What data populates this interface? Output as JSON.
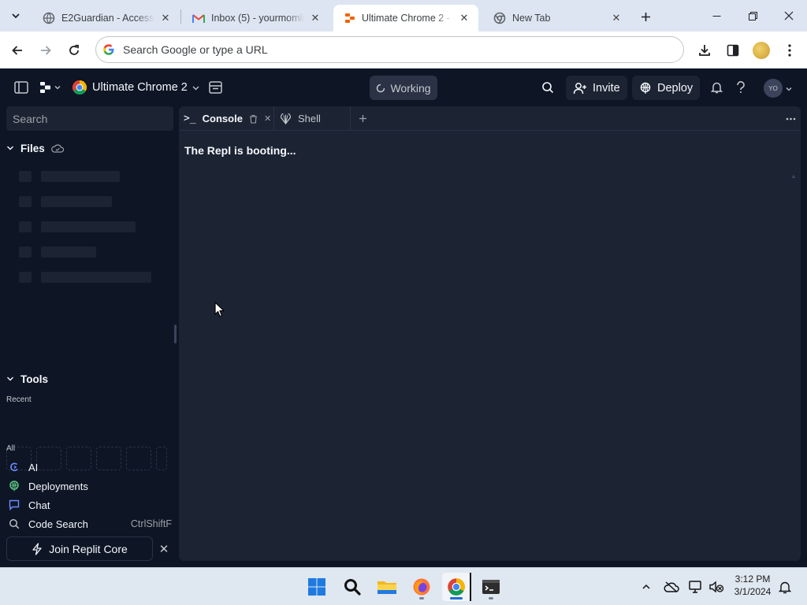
{
  "browser": {
    "tabs": [
      {
        "title": "E2Guardian - Access De",
        "icon": "shield-favicon"
      },
      {
        "title": "Inbox (5) - yourmomlik",
        "icon": "gmail-favicon"
      },
      {
        "title": "Ultimate Chrome 2 - R",
        "icon": "replit-favicon",
        "active": true
      },
      {
        "title": "New Tab",
        "icon": "chrome-favicon"
      }
    ],
    "omnibox_placeholder": "Search Google or type a URL"
  },
  "replit": {
    "repl_name": "Ultimate Chrome 2",
    "status": "Working",
    "invite_label": "Invite",
    "deploy_label": "Deploy",
    "user_initials": "YO",
    "search_placeholder": "Search",
    "files_title": "Files",
    "tools_title": "Tools",
    "recent_label": "Recent",
    "all_label": "All",
    "tools": [
      {
        "label": "AI",
        "icon": "ai-icon",
        "color": "#6b8cff"
      },
      {
        "label": "Deployments",
        "icon": "deployments-icon",
        "color": "#58c27d"
      },
      {
        "label": "Chat",
        "icon": "chat-icon",
        "color": "#6b8cff"
      },
      {
        "label": "Code Search",
        "icon": "code-search-icon",
        "color": "#c2c8cc",
        "shortcut": "CtrlShiftF"
      }
    ],
    "join_core_label": "Join Replit Core",
    "workspace_tabs": [
      {
        "label": "Console",
        "icon": "terminal-icon",
        "active": true
      },
      {
        "label": "Shell",
        "icon": "shell-icon"
      }
    ],
    "console_message": "The Repl is booting..."
  },
  "taskbar": {
    "time": "3:12 PM",
    "date": "3/1/2024"
  },
  "colors": {
    "replit_bg": "#0e1525",
    "replit_panel": "#1c2333",
    "chrome_tabstrip": "#dee5f2",
    "taskbar": "#dfe7f0"
  }
}
